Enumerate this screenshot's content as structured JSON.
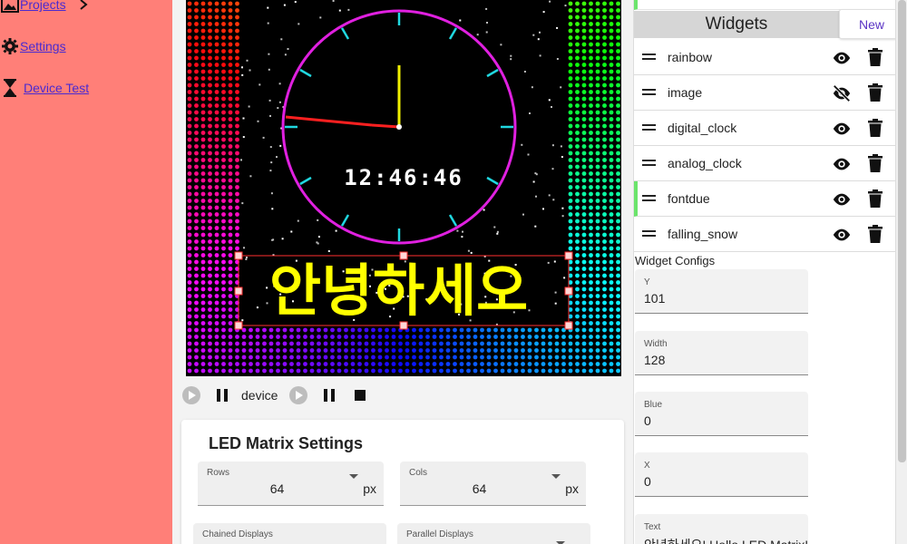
{
  "sidebar": {
    "items": [
      {
        "label": "Projects",
        "icon": "image-icon"
      },
      {
        "label": "Settings",
        "icon": "gear-icon"
      },
      {
        "label": "Device Test",
        "icon": "hourglass-icon"
      }
    ]
  },
  "preview": {
    "clock_time": "12:46:46",
    "banner_text": "안녕하세오"
  },
  "playbar": {
    "device_label": "device"
  },
  "led_settings": {
    "title": "LED Matrix Settings",
    "rows": {
      "label": "Rows",
      "value": "64",
      "unit": "px"
    },
    "cols": {
      "label": "Cols",
      "value": "64",
      "unit": "px"
    },
    "chained": {
      "label": "Chained Displays"
    },
    "parallel": {
      "label": "Parallel Displays"
    }
  },
  "widgets": {
    "title": "Widgets",
    "new_label": "New",
    "items": [
      {
        "name": "rainbow",
        "visible": true
      },
      {
        "name": "image",
        "visible": false
      },
      {
        "name": "digital_clock",
        "visible": true
      },
      {
        "name": "analog_clock",
        "visible": true
      },
      {
        "name": "fontdue",
        "visible": true,
        "active": true
      },
      {
        "name": "falling_snow",
        "visible": true
      }
    ]
  },
  "configs": {
    "title": "Widget Configs",
    "fields": [
      {
        "label": "Y",
        "value": "101"
      },
      {
        "label": "Width",
        "value": "128"
      },
      {
        "label": "Blue",
        "value": "0"
      },
      {
        "label": "X",
        "value": "0"
      },
      {
        "label": "Text",
        "value": "안녕하세오! Hello LED Matrix!"
      }
    ]
  },
  "colors": {
    "sidebar_bg": "#ff7f78",
    "link": "#4a2ad0",
    "accent_green": "#6be46b",
    "new_button_text": "#5a33c4",
    "clock_ring": "#e020e0",
    "clock_ticks": "#20d8e0",
    "banner_text": "#ffff00",
    "selection": "#ff3030"
  }
}
